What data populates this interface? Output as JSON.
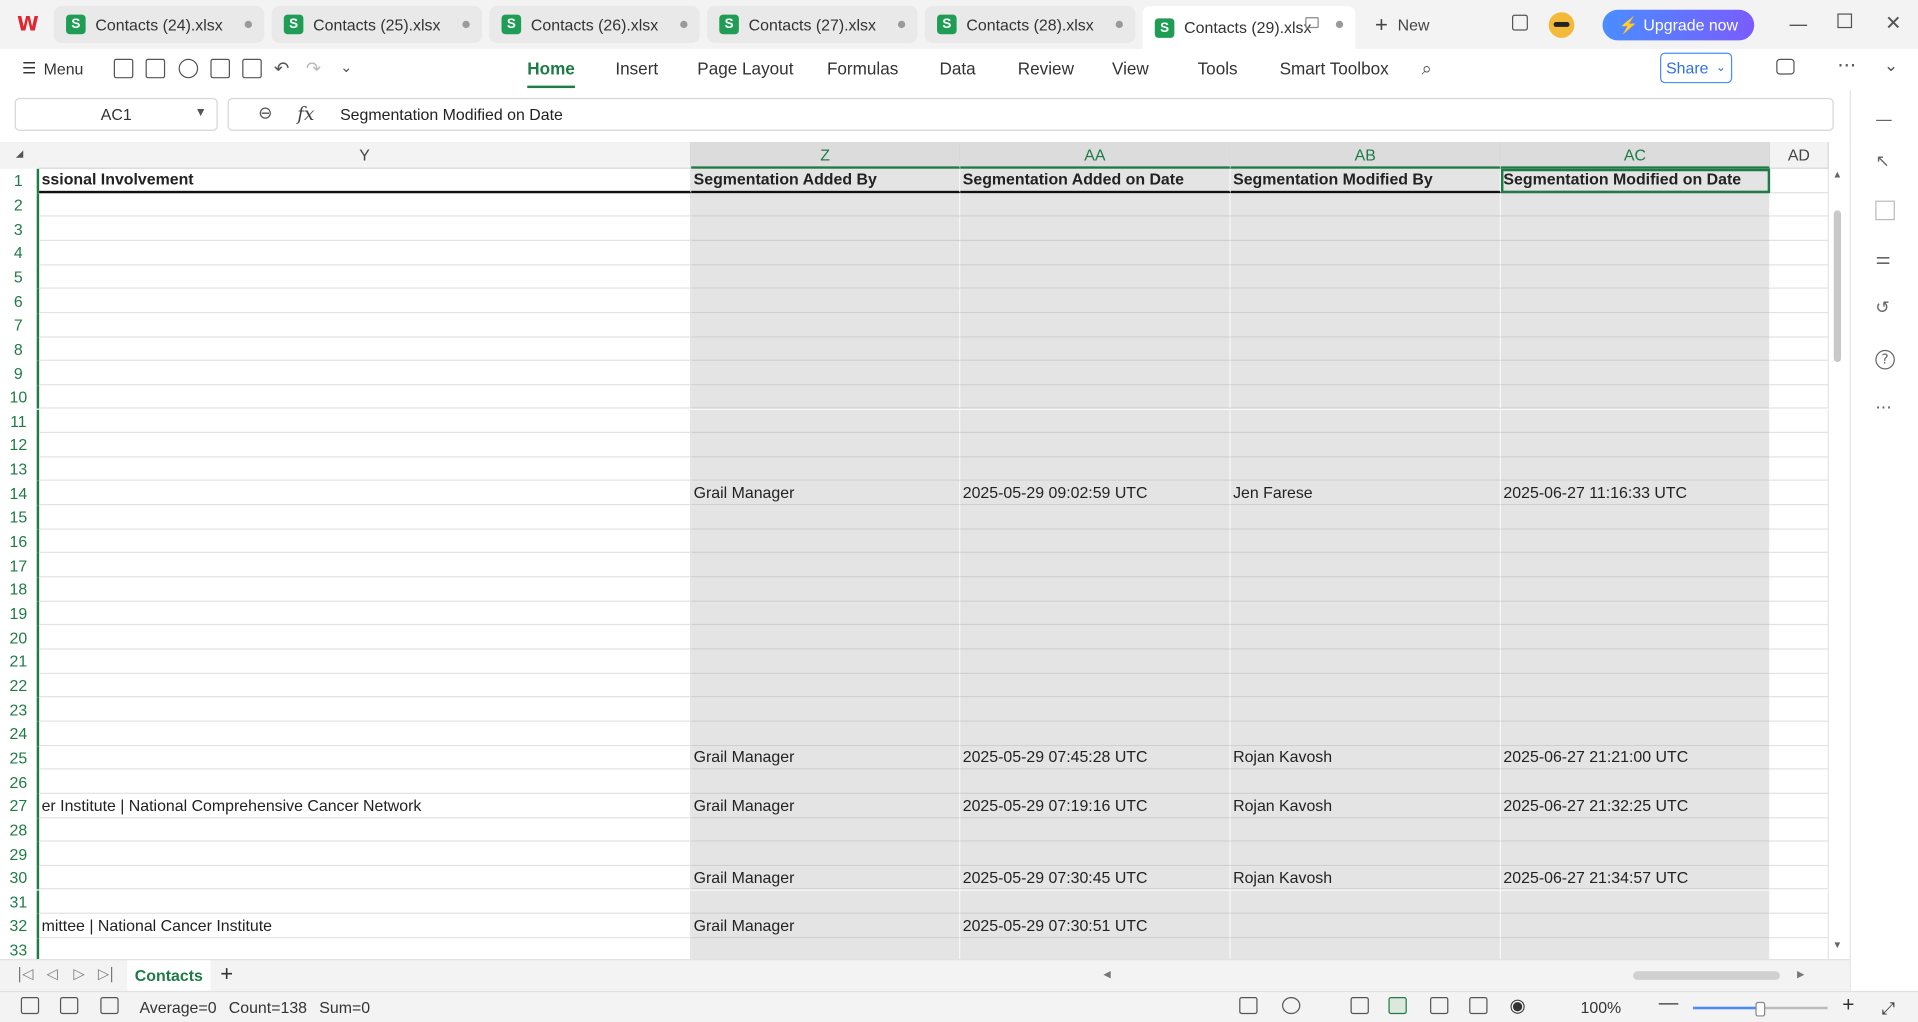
{
  "tabs": [
    {
      "label": "Contacts (24).xlsx",
      "badge": "S"
    },
    {
      "label": "Contacts (25).xlsx",
      "badge": "S"
    },
    {
      "label": "Contacts (26).xlsx",
      "badge": "S"
    },
    {
      "label": "Contacts (27).xlsx",
      "badge": "S"
    },
    {
      "label": "Contacts (28).xlsx",
      "badge": "S"
    },
    {
      "label": "Contacts (29).xlsx",
      "badge": "S"
    }
  ],
  "new_tab_label": "New",
  "upgrade_label": "Upgrade now",
  "ribbon": {
    "menu_label": "Menu",
    "tabs": [
      "Home",
      "Insert",
      "Page Layout",
      "Formulas",
      "Data",
      "Review",
      "View",
      "Tools",
      "Smart Toolbox"
    ],
    "active_tab": "Home",
    "share_label": "Share"
  },
  "formula_bar": {
    "cell_ref": "AC1",
    "fx": "fx",
    "content": "Segmentation Modified on Date"
  },
  "grid": {
    "columns": [
      "Y",
      "Z",
      "AA",
      "AB",
      "AC",
      "AD"
    ],
    "selected_column": "AC",
    "header_row": {
      "Y": "ssional Involvement",
      "Z": "Segmentation Added By",
      "AA": "Segmentation Added on Date",
      "AB": "Segmentation Modified By",
      "AC": "Segmentation Modified on Date"
    },
    "rows": [
      {
        "n": "1"
      },
      {
        "n": "2"
      },
      {
        "n": "3"
      },
      {
        "n": "4"
      },
      {
        "n": "5"
      },
      {
        "n": "6"
      },
      {
        "n": "7"
      },
      {
        "n": "8"
      },
      {
        "n": "9"
      },
      {
        "n": "10"
      },
      {
        "n": "11"
      },
      {
        "n": "12"
      },
      {
        "n": "13"
      },
      {
        "n": "14",
        "Z": "Grail Manager",
        "AA": "2025-05-29 09:02:59 UTC",
        "AB": "Jen Farese",
        "AC": "2025-06-27 11:16:33 UTC"
      },
      {
        "n": "15"
      },
      {
        "n": "16"
      },
      {
        "n": "17"
      },
      {
        "n": "18"
      },
      {
        "n": "19"
      },
      {
        "n": "20"
      },
      {
        "n": "21"
      },
      {
        "n": "22"
      },
      {
        "n": "23"
      },
      {
        "n": "24"
      },
      {
        "n": "25",
        "Z": "Grail Manager",
        "AA": "2025-05-29 07:45:28 UTC",
        "AB": "Rojan Kavosh",
        "AC": "2025-06-27 21:21:00 UTC"
      },
      {
        "n": "26"
      },
      {
        "n": "27",
        "Y": "er Institute | National Comprehensive Cancer Network",
        "Z": "Grail Manager",
        "AA": "2025-05-29 07:19:16 UTC",
        "AB": "Rojan Kavosh",
        "AC": "2025-06-27 21:32:25 UTC"
      },
      {
        "n": "28"
      },
      {
        "n": "29"
      },
      {
        "n": "30",
        "Z": "Grail Manager",
        "AA": "2025-05-29 07:30:45 UTC",
        "AB": "Rojan Kavosh",
        "AC": "2025-06-27 21:34:57 UTC"
      },
      {
        "n": "31"
      },
      {
        "n": "32",
        "Y": "mittee | National Cancer Institute",
        "Z": "Grail Manager",
        "AA": "2025-05-29 07:30:51 UTC"
      },
      {
        "n": "33"
      }
    ]
  },
  "sheet_tab": "Contacts",
  "status": {
    "average": "Average=0",
    "count": "Count=138",
    "sum": "Sum=0",
    "zoom": "100%"
  },
  "colors": {
    "accent": "#1e7b46",
    "shaded": "#e4e4e4",
    "upgrade": "#4a8dff"
  }
}
